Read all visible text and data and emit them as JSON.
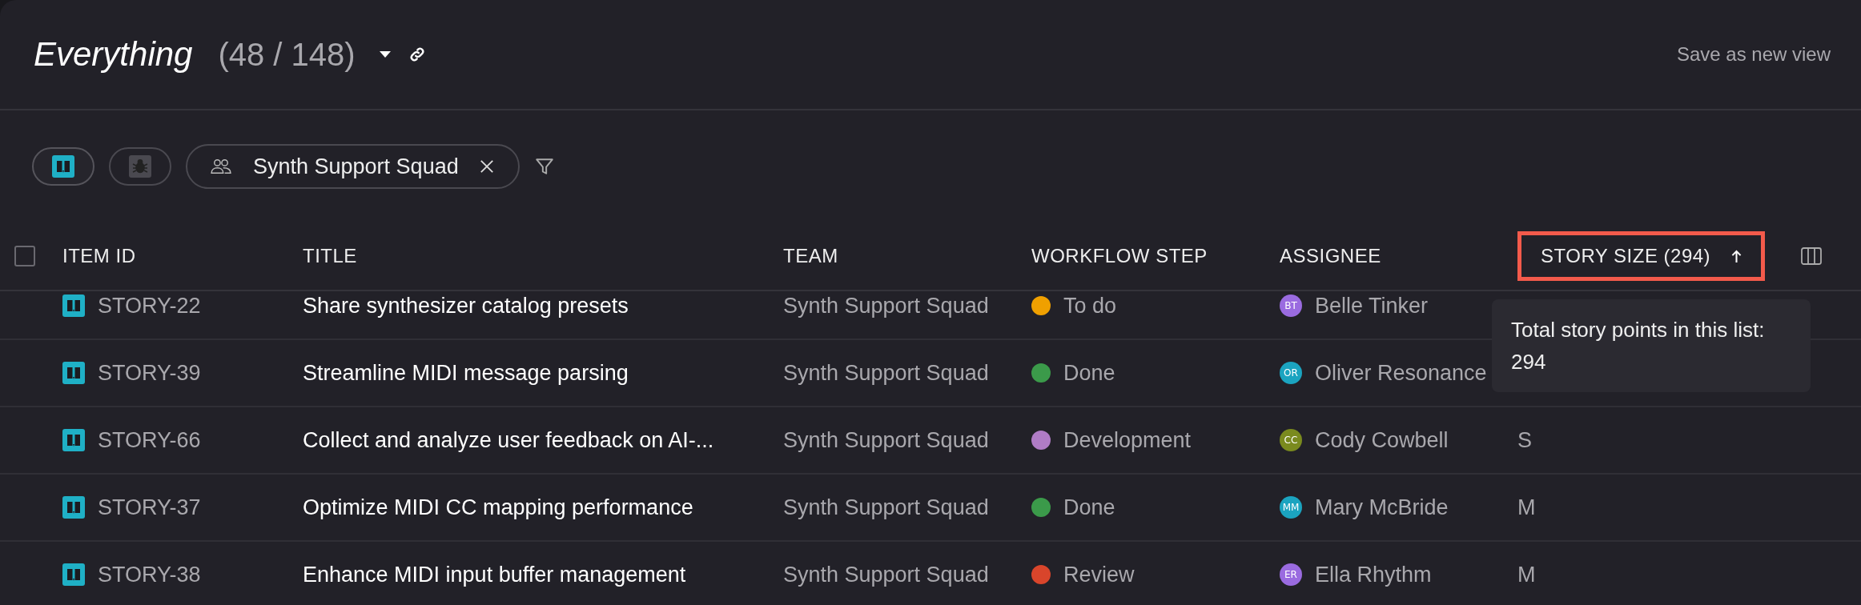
{
  "view": {
    "title": "Everything",
    "count": "(48 / 148)",
    "save_label": "Save as new view"
  },
  "type_filters": [
    {
      "kind": "story",
      "selected": true
    },
    {
      "kind": "bug",
      "selected": false
    }
  ],
  "team_filter": {
    "label": "Synth Support Squad"
  },
  "table": {
    "select_all": {
      "checked": false
    },
    "columns": [
      {
        "label": "ITEM ID"
      },
      {
        "label": "TITLE"
      },
      {
        "label": "TEAM"
      },
      {
        "label": "WORKFLOW STEP"
      },
      {
        "label": "ASSIGNEE"
      },
      {
        "label": "STORY SIZE (294)",
        "sorted_ascending": true,
        "highlighted": true
      }
    ],
    "rows": [
      {
        "id": "STORY-22",
        "title": "Share synthesizer catalog presets",
        "team": "Synth Support Squad",
        "step": {
          "label": "To do",
          "color": "#f0a000"
        },
        "assignee": {
          "initials": "BT",
          "name": "Belle Tinker",
          "color": "#9a6be0"
        }
      },
      {
        "id": "STORY-39",
        "title": "Streamline MIDI message parsing",
        "team": "Synth Support Squad",
        "step": {
          "label": "Done",
          "color": "#3b9a4a"
        },
        "assignee": {
          "initials": "OR",
          "name": "Oliver Resonance",
          "color": "#1ba4c0"
        }
      },
      {
        "id": "STORY-66",
        "title": "Collect and analyze user feedback on AI-...",
        "team": "Synth Support Squad",
        "step": {
          "label": "Development",
          "color": "#b07cc6"
        },
        "assignee": {
          "initials": "CC",
          "name": "Cody Cowbell",
          "color": "#7a8a1e"
        },
        "size": "S"
      },
      {
        "id": "STORY-37",
        "title": "Optimize MIDI CC mapping performance",
        "team": "Synth Support Squad",
        "step": {
          "label": "Done",
          "color": "#3b9a4a"
        },
        "assignee": {
          "initials": "MM",
          "name": "Mary McBride",
          "color": "#1ba4c0"
        },
        "size": "M"
      },
      {
        "id": "STORY-38",
        "title": "Enhance MIDI input buffer management",
        "team": "Synth Support Squad",
        "step": {
          "label": "Review",
          "color": "#d9452b"
        },
        "assignee": {
          "initials": "ER",
          "name": "Ella Rhythm",
          "color": "#9a6be0"
        },
        "size": "M"
      }
    ]
  },
  "tooltip": {
    "text": "Total story points in this list: 294"
  }
}
